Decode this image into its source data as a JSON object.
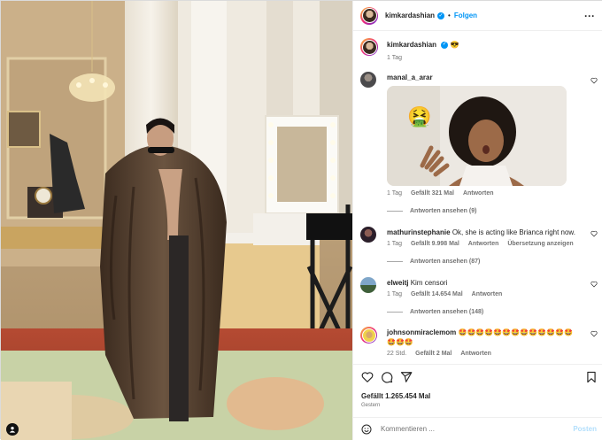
{
  "post": {
    "username": "kimkardashian",
    "follow_label": "Folgen",
    "separator": "•",
    "caption_emoji": "😎",
    "caption_time": "1 Tag",
    "likes": "Gefällt 1.265.454 Mal",
    "date": "Gestern"
  },
  "comments": [
    {
      "username": "manal_a_arar",
      "text": "",
      "time": "1 Tag",
      "likes": "Gefällt 321 Mal",
      "reply": "Antworten",
      "view_replies": "Antworten ansehen (9)",
      "gif_emoji": "🤮"
    },
    {
      "username": "mathurinstephanie",
      "text": "Ok, she is acting like Brianca right now.",
      "time": "1 Tag",
      "likes": "Gefällt 9.998 Mal",
      "reply": "Antworten",
      "translate": "Übersetzung anzeigen",
      "view_replies": "Antworten ansehen (87)"
    },
    {
      "username": "elweitj",
      "text": "Kim censori",
      "time": "1 Tag",
      "likes": "Gefällt 14.654 Mal",
      "reply": "Antworten",
      "view_replies": "Antworten ansehen (148)"
    },
    {
      "username": "johnsonmiraclemom",
      "text": "🤩🤩🤩🤩🤩🤩🤩🤩🤩🤩🤩🤩🤩🤩🤩🤩",
      "time": "22 Std.",
      "likes": "Gefällt 2 Mal",
      "reply": "Antworten"
    }
  ],
  "comment_box": {
    "placeholder": "Kommentieren ...",
    "post_label": "Posten"
  },
  "colors": {
    "accent": "#0095f6",
    "muted": "#737373",
    "border": "#efefef"
  },
  "icons": [
    "more-icon",
    "heart-icon",
    "comment-icon",
    "share-icon",
    "bookmark-icon",
    "emoji-icon",
    "user-tag-icon",
    "verified-icon"
  ]
}
